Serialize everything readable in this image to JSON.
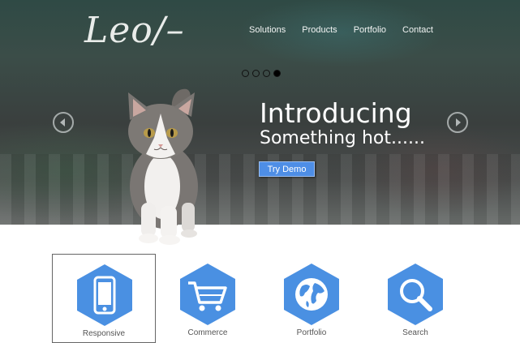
{
  "brand": {
    "logo_text": "Leo/–"
  },
  "nav": {
    "items": [
      {
        "label": "Solutions"
      },
      {
        "label": "Products"
      },
      {
        "label": "Portfolio"
      },
      {
        "label": "Contact"
      }
    ]
  },
  "slider": {
    "slide_count": 4,
    "active_index": 3,
    "title": "Introducing",
    "subtitle": "Something hot......",
    "cta_label": "Try Demo",
    "prev_icon": "chevron-left-icon",
    "next_icon": "chevron-right-icon"
  },
  "features": {
    "items": [
      {
        "icon": "mobile-phone-icon",
        "label": "Responsive",
        "selected": true
      },
      {
        "icon": "shopping-cart-icon",
        "label": "Commerce",
        "selected": false
      },
      {
        "icon": "globe-icon",
        "label": "Portfolio",
        "selected": false
      },
      {
        "icon": "search-icon",
        "label": "Search",
        "selected": false
      }
    ]
  },
  "colors": {
    "accent": "#4a8fe3",
    "button": "#4e8ee6",
    "hex_fill": "#4a90e2"
  }
}
